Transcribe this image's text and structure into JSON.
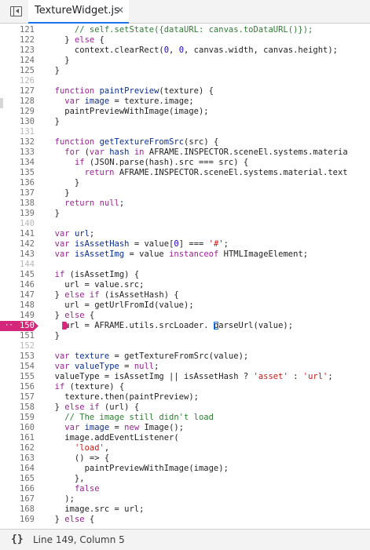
{
  "tab": {
    "filename": "TextureWidget.js",
    "close_glyph": "✕"
  },
  "status": {
    "format_glyph": "{}",
    "position": "Line 149, Column 5"
  },
  "colors": {
    "breakpoint": "#d4267a",
    "tab_accent": "#1a73e8"
  },
  "breakpoint": {
    "line": "150",
    "dots": "··"
  },
  "lines": [
    {
      "n": "121",
      "t": [
        [
          "cmt",
          "      // self.setState({dataURL: canvas.toDataURL()});"
        ]
      ]
    },
    {
      "n": "122",
      "t": [
        [
          "",
          "    } "
        ],
        [
          "kw",
          "else"
        ],
        [
          "",
          " {"
        ]
      ]
    },
    {
      "n": "123",
      "t": [
        [
          "",
          "      context.clearRect("
        ],
        [
          "num",
          "0"
        ],
        [
          "",
          ", "
        ],
        [
          "num",
          "0"
        ],
        [
          "",
          ", canvas.width, canvas.height);"
        ]
      ]
    },
    {
      "n": "124",
      "t": [
        [
          "",
          "    }"
        ]
      ]
    },
    {
      "n": "125",
      "t": [
        [
          "",
          "  }"
        ]
      ]
    },
    {
      "n": "126",
      "t": []
    },
    {
      "n": "127",
      "t": [
        [
          "",
          "  "
        ],
        [
          "kw",
          "function"
        ],
        [
          "",
          " "
        ],
        [
          "def",
          "paintPreview"
        ],
        [
          "",
          "(texture) {"
        ]
      ]
    },
    {
      "n": "128",
      "t": [
        [
          "",
          "    "
        ],
        [
          "kw",
          "var"
        ],
        [
          "",
          " "
        ],
        [
          "def",
          "image"
        ],
        [
          "",
          " = texture.image;"
        ]
      ]
    },
    {
      "n": "129",
      "t": [
        [
          "",
          "    paintPreviewWithImage(image);"
        ]
      ]
    },
    {
      "n": "130",
      "t": [
        [
          "",
          "  }"
        ]
      ]
    },
    {
      "n": "131",
      "t": []
    },
    {
      "n": "132",
      "t": [
        [
          "",
          "  "
        ],
        [
          "kw",
          "function"
        ],
        [
          "",
          " "
        ],
        [
          "def",
          "getTextureFromSrc"
        ],
        [
          "",
          "(src) {"
        ]
      ]
    },
    {
      "n": "133",
      "t": [
        [
          "",
          "    "
        ],
        [
          "kw",
          "for"
        ],
        [
          "",
          " ("
        ],
        [
          "kw",
          "var"
        ],
        [
          "",
          " "
        ],
        [
          "def",
          "hash"
        ],
        [
          "",
          " "
        ],
        [
          "kw",
          "in"
        ],
        [
          "",
          " AFRAME.INSPECTOR.sceneEl.systems.materia"
        ]
      ]
    },
    {
      "n": "134",
      "t": [
        [
          "",
          "      "
        ],
        [
          "kw",
          "if"
        ],
        [
          "",
          " (JSON.parse(hash).src === src) {"
        ]
      ]
    },
    {
      "n": "135",
      "t": [
        [
          "",
          "        "
        ],
        [
          "kw",
          "return"
        ],
        [
          "",
          " AFRAME.INSPECTOR.sceneEl.systems.material.text"
        ]
      ]
    },
    {
      "n": "136",
      "t": [
        [
          "",
          "      }"
        ]
      ]
    },
    {
      "n": "137",
      "t": [
        [
          "",
          "    }"
        ]
      ]
    },
    {
      "n": "138",
      "t": [
        [
          "",
          "    "
        ],
        [
          "kw",
          "return"
        ],
        [
          "",
          " "
        ],
        [
          "kw",
          "null"
        ],
        [
          "",
          ";"
        ]
      ]
    },
    {
      "n": "139",
      "t": [
        [
          "",
          "  }"
        ]
      ]
    },
    {
      "n": "140",
      "t": []
    },
    {
      "n": "141",
      "t": [
        [
          "",
          "  "
        ],
        [
          "kw",
          "var"
        ],
        [
          "",
          " "
        ],
        [
          "def",
          "url"
        ],
        [
          "",
          ";"
        ]
      ]
    },
    {
      "n": "142",
      "t": [
        [
          "",
          "  "
        ],
        [
          "kw",
          "var"
        ],
        [
          "",
          " "
        ],
        [
          "def",
          "isAssetHash"
        ],
        [
          "",
          " = value["
        ],
        [
          "num",
          "0"
        ],
        [
          "",
          "] === "
        ],
        [
          "str",
          "'#'"
        ],
        [
          "",
          ";"
        ]
      ]
    },
    {
      "n": "143",
      "t": [
        [
          "",
          "  "
        ],
        [
          "kw",
          "var"
        ],
        [
          "",
          " "
        ],
        [
          "def",
          "isAssetImg"
        ],
        [
          "",
          " = value "
        ],
        [
          "kw",
          "instanceof"
        ],
        [
          "",
          " HTMLImageElement;"
        ]
      ]
    },
    {
      "n": "144",
      "t": []
    },
    {
      "n": "145",
      "t": [
        [
          "",
          "  "
        ],
        [
          "kw",
          "if"
        ],
        [
          "",
          " (isAssetImg) {"
        ]
      ]
    },
    {
      "n": "146",
      "t": [
        [
          "",
          "    url = value.src;"
        ]
      ]
    },
    {
      "n": "147",
      "t": [
        [
          "",
          "  } "
        ],
        [
          "kw",
          "else if"
        ],
        [
          "",
          " (isAssetHash) {"
        ]
      ]
    },
    {
      "n": "148",
      "t": [
        [
          "",
          "    url = getUrlFromId(value);"
        ]
      ]
    },
    {
      "n": "149",
      "t": [
        [
          "",
          "  } "
        ],
        [
          "kw",
          "else"
        ],
        [
          "",
          " {"
        ]
      ]
    },
    {
      "n": "150",
      "t": [
        [
          "",
          "    url = AFRAME.utils.srcLoader. parseUrl(value);"
        ]
      ]
    },
    {
      "n": "151",
      "t": [
        [
          "",
          "  }"
        ]
      ]
    },
    {
      "n": "152",
      "t": []
    },
    {
      "n": "153",
      "t": [
        [
          "",
          "  "
        ],
        [
          "kw",
          "var"
        ],
        [
          "",
          " "
        ],
        [
          "def",
          "texture"
        ],
        [
          "",
          " = getTextureFromSrc(value);"
        ]
      ]
    },
    {
      "n": "154",
      "t": [
        [
          "",
          "  "
        ],
        [
          "kw",
          "var"
        ],
        [
          "",
          " "
        ],
        [
          "def",
          "valueType"
        ],
        [
          "",
          " = "
        ],
        [
          "kw",
          "null"
        ],
        [
          "",
          ";"
        ]
      ]
    },
    {
      "n": "155",
      "t": [
        [
          "",
          "  valueType = isAssetImg || isAssetHash ? "
        ],
        [
          "str",
          "'asset'"
        ],
        [
          "",
          " : "
        ],
        [
          "str",
          "'url'"
        ],
        [
          "",
          ";"
        ]
      ]
    },
    {
      "n": "156",
      "t": [
        [
          "",
          "  "
        ],
        [
          "kw",
          "if"
        ],
        [
          "",
          " (texture) {"
        ]
      ]
    },
    {
      "n": "157",
      "t": [
        [
          "",
          "    texture.then(paintPreview);"
        ]
      ]
    },
    {
      "n": "158",
      "t": [
        [
          "",
          "  } "
        ],
        [
          "kw",
          "else if"
        ],
        [
          "",
          " (url) {"
        ]
      ]
    },
    {
      "n": "159",
      "t": [
        [
          "cmt",
          "    // The image still didn't load"
        ]
      ]
    },
    {
      "n": "160",
      "t": [
        [
          "",
          "    "
        ],
        [
          "kw",
          "var"
        ],
        [
          "",
          " "
        ],
        [
          "def",
          "image"
        ],
        [
          "",
          " = "
        ],
        [
          "kw",
          "new"
        ],
        [
          "",
          " Image();"
        ]
      ]
    },
    {
      "n": "161",
      "t": [
        [
          "",
          "    image.addEventListener("
        ]
      ]
    },
    {
      "n": "162",
      "t": [
        [
          "",
          "      "
        ],
        [
          "str",
          "'load'"
        ],
        [
          "",
          ","
        ]
      ]
    },
    {
      "n": "163",
      "t": [
        [
          "",
          "      () => {"
        ]
      ]
    },
    {
      "n": "164",
      "t": [
        [
          "",
          "        paintPreviewWithImage(image);"
        ]
      ]
    },
    {
      "n": "165",
      "t": [
        [
          "",
          "      },"
        ]
      ]
    },
    {
      "n": "166",
      "t": [
        [
          "",
          "      "
        ],
        [
          "kw",
          "false"
        ]
      ]
    },
    {
      "n": "167",
      "t": [
        [
          "",
          "    );"
        ]
      ]
    },
    {
      "n": "168",
      "t": [
        [
          "",
          "    image.src = url;"
        ]
      ]
    },
    {
      "n": "169",
      "t": [
        [
          "",
          "  } "
        ],
        [
          "kw",
          "else"
        ],
        [
          "",
          " {"
        ]
      ]
    }
  ]
}
